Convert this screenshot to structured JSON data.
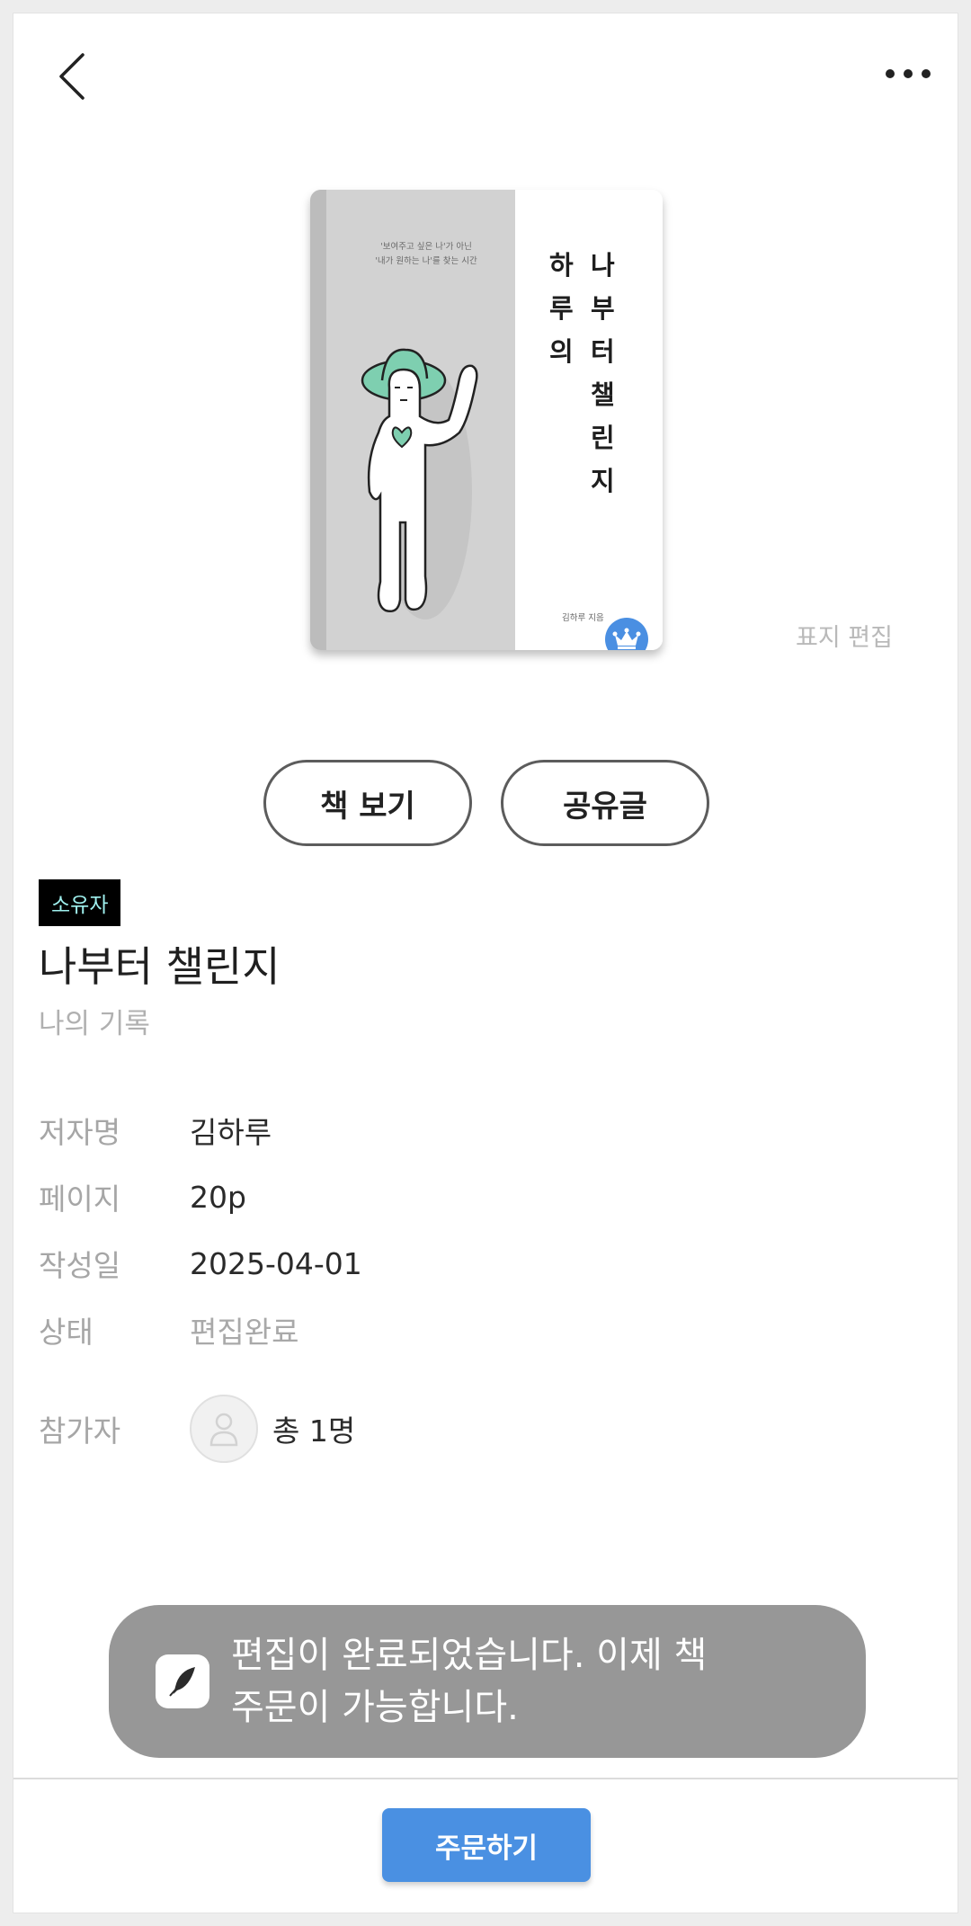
{
  "header": {
    "back_icon": "chevron-left-icon",
    "more_icon": "more-horizontal-icon"
  },
  "cover": {
    "tagline_line1": "'보여주고 싶은 나'가 아닌",
    "tagline_line2": "'내가 원하는 나'를 찾는 시간",
    "title_col_a": [
      "나",
      "부",
      "터",
      "챌",
      "린",
      "지"
    ],
    "title_col_b": [
      "하",
      "루",
      "의"
    ],
    "author": "김하루 지음",
    "badge_icon": "crown-icon",
    "accent_color": "#7ecfb0",
    "badge_color": "#4a8fe2"
  },
  "edit_cover_label": "표지 편집",
  "buttons": {
    "view_book": "책 보기",
    "share_post": "공유글"
  },
  "book": {
    "owner_badge": "소유자",
    "title": "나부터 챌린지",
    "category": "나의 기록"
  },
  "info": {
    "author_label": "저자명",
    "author_value": "김하루",
    "pages_label": "페이지",
    "pages_value": "20p",
    "date_label": "작성일",
    "date_value": "2025-04-01",
    "status_label": "상태",
    "status_value": "편집완료",
    "participants_label": "참가자",
    "participants_value": "총 1명"
  },
  "toast": {
    "icon": "quill-icon",
    "line1": "편집이 완료되었습니다. 이제 책",
    "line2": "주문이 가능합니다."
  },
  "footer": {
    "order_label": "주문하기",
    "order_color": "#4a90e2"
  }
}
